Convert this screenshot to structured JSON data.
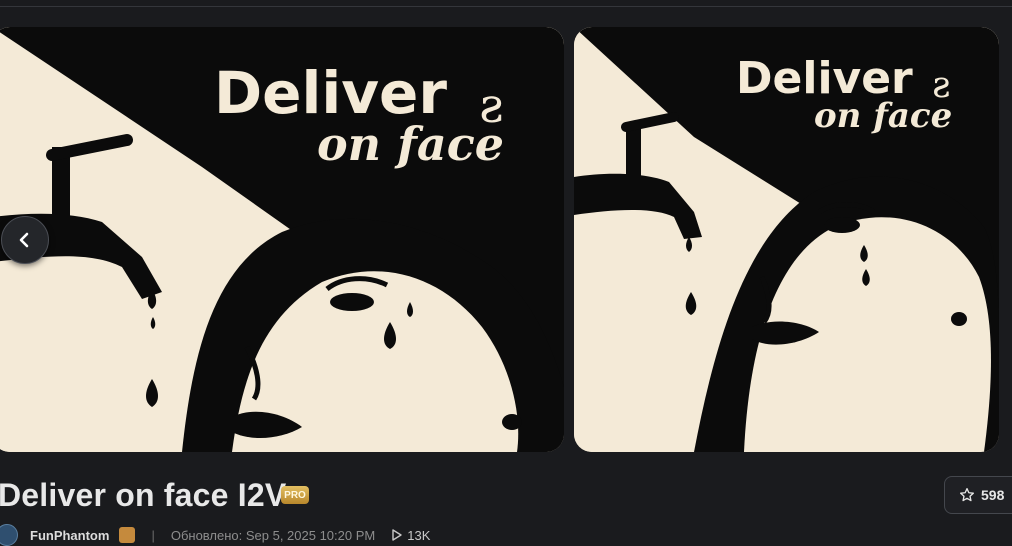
{
  "model": {
    "title": "Deliver on face I2V",
    "badge": "PRO",
    "stars": "598",
    "author": "FunPhantom",
    "updated": "Обновлено: Sep 5, 2025 10:20 PM",
    "separator": "|",
    "views": "13K"
  },
  "gallery": {
    "image_1": {
      "line1": "Deliver",
      "line2": "on face"
    },
    "image_2": {
      "line1": "Deliver",
      "line2": "on face"
    }
  },
  "icons": {
    "prev": "chevron-left-icon",
    "star": "star-icon",
    "views": "play-icon"
  },
  "colors": {
    "background": "#1a1b1e",
    "card_bg": "#f4ead7",
    "ink": "#0b0b0b",
    "pro_badge": "#d4a94a"
  }
}
